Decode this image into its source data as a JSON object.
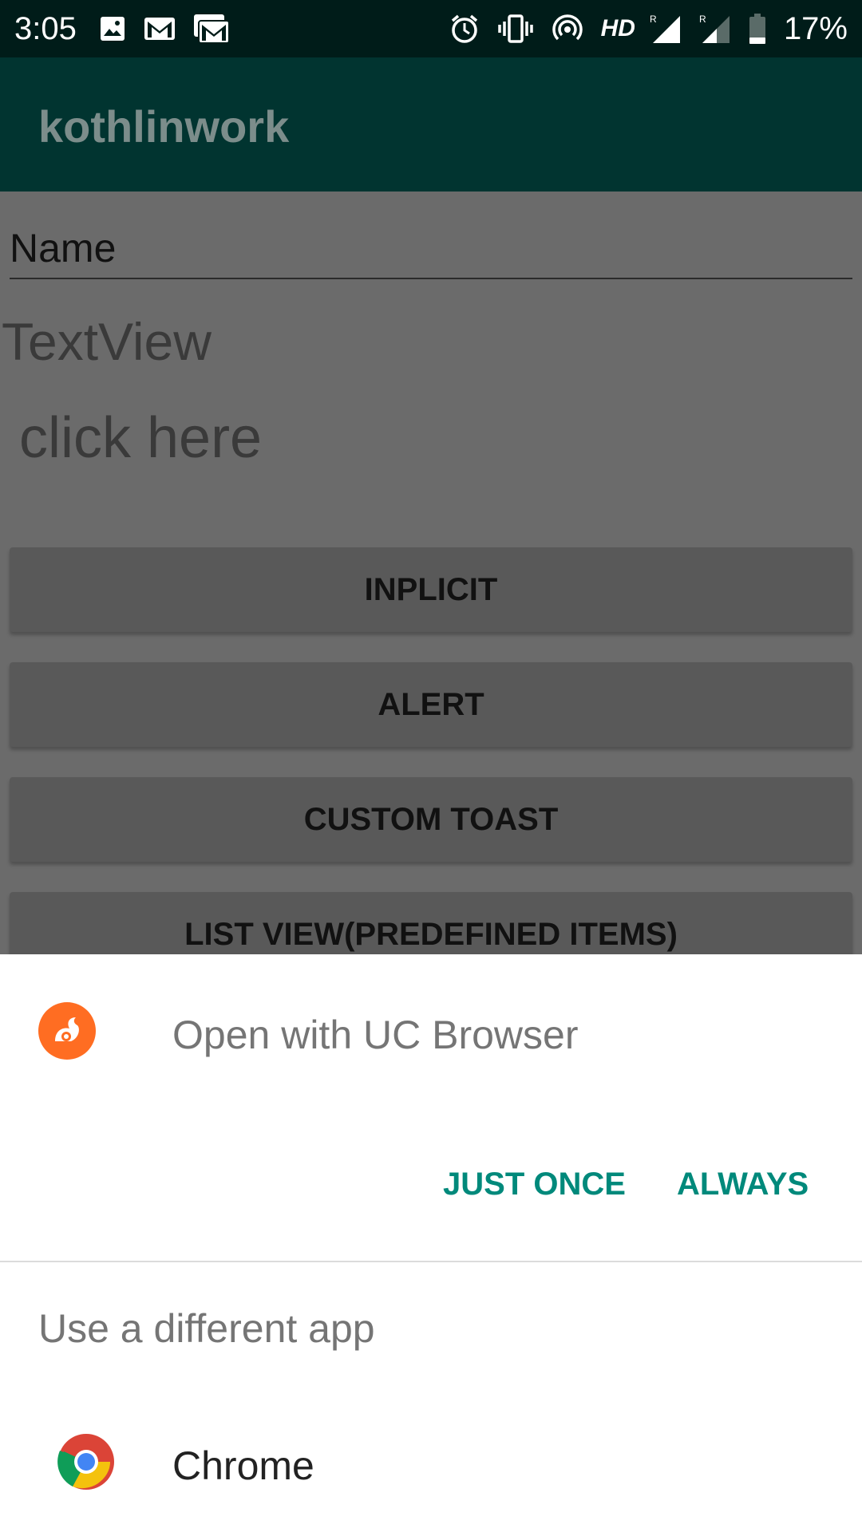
{
  "status_bar": {
    "time": "3:05",
    "network": "HD",
    "battery": "17%",
    "icons": [
      "image-icon",
      "gmail-icon",
      "gmail-icon",
      "alarm-icon",
      "vibrate-icon",
      "hotspot-icon",
      "signal-icon",
      "signal-icon",
      "battery-icon"
    ]
  },
  "app_bar": {
    "title": "kothlinwork"
  },
  "content": {
    "name_field": {
      "value": "Name"
    },
    "textview": "TextView",
    "click_here": "click here",
    "buttons": [
      "INPLICIT",
      "ALERT",
      "CUSTOM TOAST",
      "LIST VIEW(PREDEFINED ITEMS)"
    ]
  },
  "dialog": {
    "open_with": "Open with UC Browser",
    "just_once": "JUST ONCE",
    "always": "ALWAYS",
    "different_app": "Use a different app",
    "apps": [
      {
        "label": "Chrome",
        "icon": "chrome-icon"
      }
    ],
    "accent_color": "#00897b"
  },
  "colors": {
    "status_bar": "#001c19",
    "app_bar": "#013430",
    "scrim_bg": "#6b6b6b",
    "button_bg": "#595959"
  }
}
